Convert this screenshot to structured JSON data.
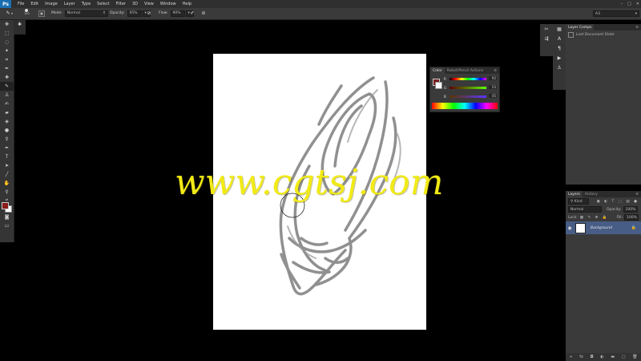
{
  "app": {
    "logo": "Ps"
  },
  "menu": [
    "File",
    "Edit",
    "Image",
    "Layer",
    "Type",
    "Select",
    "Filter",
    "3D",
    "View",
    "Window",
    "Help"
  ],
  "window_controls": {
    "minimize": "–",
    "restore": "□",
    "close": "✕"
  },
  "options": {
    "brush_size": "100",
    "mode_label": "Mode:",
    "mode_value": "Normal",
    "opacity_label": "Opacity:",
    "opacity_value": "95%",
    "flow_label": "Flow:",
    "flow_value": "90%"
  },
  "workspace": "A3",
  "layer_comps": {
    "tab": "Layer Comps",
    "item": "Last Document State"
  },
  "color_panel": {
    "tabs": [
      "Color",
      "Robot/Pencil Actions"
    ],
    "r_label": "R",
    "r_value": "92",
    "g_label": "G",
    "g_value": "53",
    "b_label": "B",
    "b_value": "45",
    "fg_color": "#7a1f1f",
    "bg_color": "#ffffff"
  },
  "layers": {
    "tabs": [
      "Layers",
      "History"
    ],
    "kind": "Kind",
    "blend": "Normal",
    "opacity_label": "Opacity:",
    "opacity_value": "100%",
    "lock_label": "Lock:",
    "fill_label": "Fill:",
    "fill_value": "100%",
    "layer_name": "Background"
  },
  "watermark": "www.cgtsj.com",
  "colors": {
    "accent": "#1a6fb2",
    "selected_layer": "#475d86",
    "watermark": "#f2ea16"
  }
}
